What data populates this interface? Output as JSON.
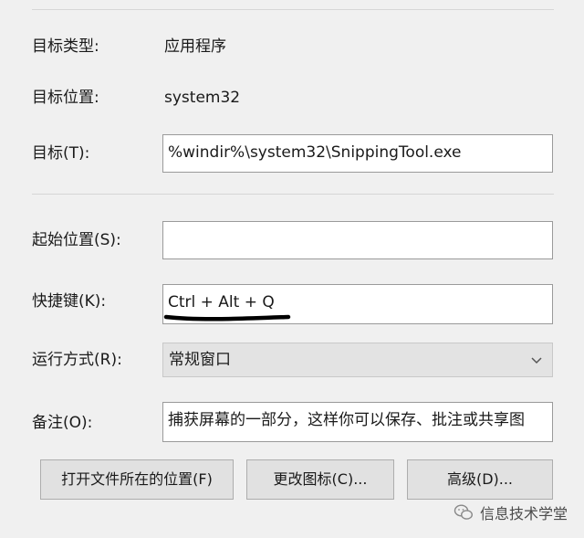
{
  "fields": {
    "target_type": {
      "label": "目标类型:",
      "value": "应用程序"
    },
    "target_location": {
      "label": "目标位置:",
      "value": "system32"
    },
    "target": {
      "label": "目标(T):",
      "value": "%windir%\\system32\\SnippingTool.exe"
    },
    "start_in": {
      "label": "起始位置(S):",
      "value": ""
    },
    "shortcut_key": {
      "label": "快捷键(K):",
      "value": "Ctrl + Alt + Q"
    },
    "run": {
      "label": "运行方式(R):",
      "value": "常规窗口"
    },
    "comment": {
      "label": "备注(O):",
      "value": "捕获屏幕的一部分，这样你可以保存、批注或共享图"
    }
  },
  "buttons": {
    "open_file_location": "打开文件所在的位置(F)",
    "change_icon": "更改图标(C)...",
    "advanced": "高级(D)..."
  },
  "watermark": {
    "text": "信息技术学堂",
    "icon": "wechat-icon"
  },
  "colors": {
    "background": "#f0f0f0",
    "underline_annotation": "#000000"
  }
}
